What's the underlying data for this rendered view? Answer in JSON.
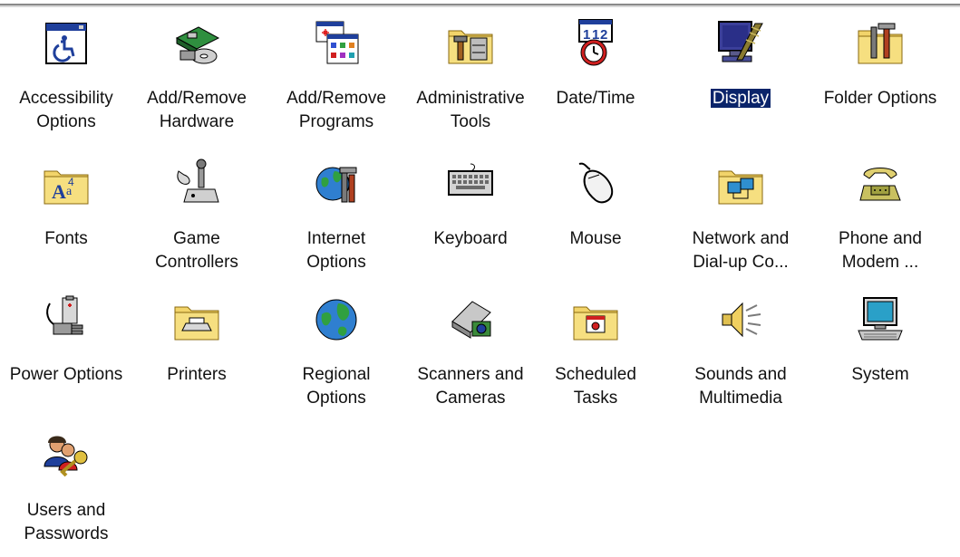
{
  "window": {
    "items": [
      {
        "name": "accessibility-options",
        "line1": "Accessibility",
        "line2": "Options",
        "icon": "accessibility-icon"
      },
      {
        "name": "add-remove-hardware",
        "line1": "Add/Remove",
        "line2": "Hardware",
        "icon": "hardware-icon"
      },
      {
        "name": "add-remove-programs",
        "line1": "Add/Remove",
        "line2": "Programs",
        "icon": "programs-icon"
      },
      {
        "name": "administrative-tools",
        "line1": "Administrative",
        "line2": "Tools",
        "icon": "tools-folder-icon"
      },
      {
        "name": "date-time",
        "line1": "Date/Time",
        "line2": "",
        "icon": "calendar-clock-icon"
      },
      {
        "name": "display",
        "line1": "Display",
        "line2": "",
        "icon": "display-icon",
        "selected": true
      },
      {
        "name": "folder-options",
        "line1": "Folder Options",
        "line2": "",
        "icon": "folder-options-icon"
      },
      {
        "name": "fonts",
        "line1": "Fonts",
        "line2": "",
        "icon": "fonts-folder-icon"
      },
      {
        "name": "game-controllers",
        "line1": "Game",
        "line2": "Controllers",
        "icon": "joystick-icon"
      },
      {
        "name": "internet-options",
        "line1": "Internet",
        "line2": "Options",
        "icon": "globe-tools-icon"
      },
      {
        "name": "keyboard",
        "line1": "Keyboard",
        "line2": "",
        "icon": "keyboard-icon"
      },
      {
        "name": "mouse",
        "line1": "Mouse",
        "line2": "",
        "icon": "mouse-icon"
      },
      {
        "name": "network-and-dial-up",
        "line1": "Network and",
        "line2": "Dial-up Co...",
        "icon": "network-folder-icon"
      },
      {
        "name": "phone-and-modem",
        "line1": "Phone and",
        "line2": "Modem ...",
        "icon": "phone-icon"
      },
      {
        "name": "power-options",
        "line1": "Power Options",
        "line2": "",
        "icon": "battery-plug-icon"
      },
      {
        "name": "printers",
        "line1": "Printers",
        "line2": "",
        "icon": "printer-folder-icon"
      },
      {
        "name": "regional-options",
        "line1": "Regional",
        "line2": "Options",
        "icon": "globe-icon"
      },
      {
        "name": "scanners-and-cameras",
        "line1": "Scanners and",
        "line2": "Cameras",
        "icon": "scanner-camera-icon"
      },
      {
        "name": "scheduled-tasks",
        "line1": "Scheduled",
        "line2": "Tasks",
        "icon": "scheduled-tasks-folder-icon"
      },
      {
        "name": "sounds-and-multimedia",
        "line1": "Sounds and",
        "line2": "Multimedia",
        "icon": "speaker-icon"
      },
      {
        "name": "system",
        "line1": "System",
        "line2": "",
        "icon": "computer-icon"
      },
      {
        "name": "users-and-passwords",
        "line1": "Users and",
        "line2": "Passwords",
        "icon": "users-key-icon"
      }
    ]
  },
  "colors": {
    "selection_bg": "#0a246a",
    "selection_text": "#ffffff",
    "folder_yellow": "#f2d46a"
  }
}
